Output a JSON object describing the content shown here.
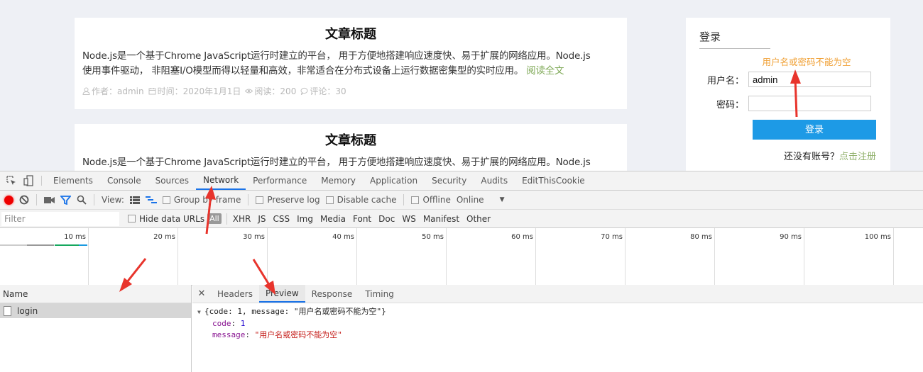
{
  "page": {
    "articles": [
      {
        "title": "文章标题",
        "body_line1": "Node.js是一个基于Chrome JavaScript运行时建立的平台， 用于方便地搭建响应速度快、易于扩展的网络应用。Node.js",
        "body_line2": "使用事件驱动， 非阻塞I/O模型而得以轻量和高效，非常适合在分布式设备上运行数据密集型的实时应用。",
        "read_more": "阅读全文",
        "meta": {
          "author": "作者：admin",
          "time": "时间：2020年1月1日",
          "reads": "阅读：200",
          "comments": "评论：30"
        }
      },
      {
        "title": "文章标题",
        "body_line1": "Node.js是一个基于Chrome JavaScript运行时建立的平台， 用于方便地搭建响应速度快、易于扩展的网络应用。Node.js"
      }
    ],
    "login": {
      "title": "登录",
      "error": "用户名或密码不能为空",
      "username_label": "用户名：",
      "username_value": "admin",
      "password_label": "密码：",
      "password_value": "",
      "submit": "登录",
      "register_prompt": "还没有账号？",
      "register_link": "点击注册"
    }
  },
  "devtools": {
    "tabs": [
      "Elements",
      "Console",
      "Sources",
      "Network",
      "Performance",
      "Memory",
      "Application",
      "Security",
      "Audits",
      "EditThisCookie"
    ],
    "active_tab": "Network",
    "toolbar": {
      "view_label": "View:",
      "group_by_frame": "Group by frame",
      "preserve_log": "Preserve log",
      "disable_cache": "Disable cache",
      "offline": "Offline",
      "throttle": "Online"
    },
    "filterbar": {
      "placeholder": "Filter",
      "hide_data_urls": "Hide data URLs",
      "all": "All",
      "types": [
        "XHR",
        "JS",
        "CSS",
        "Img",
        "Media",
        "Font",
        "Doc",
        "WS",
        "Manifest",
        "Other"
      ]
    },
    "timeline_ticks": [
      "10 ms",
      "20 ms",
      "30 ms",
      "40 ms",
      "50 ms",
      "60 ms",
      "70 ms",
      "80 ms",
      "90 ms",
      "100 ms"
    ],
    "requests": {
      "column": "Name",
      "rows": [
        "login"
      ]
    },
    "detail": {
      "tabs": [
        "Headers",
        "Preview",
        "Response",
        "Timing"
      ],
      "active_tab": "Preview",
      "preview": {
        "summary": "{code: 1, message: \"用户名或密码不能为空\"}",
        "code_key": "code",
        "code_value": "1",
        "message_key": "message",
        "message_value": "\"用户名或密码不能为空\""
      }
    }
  },
  "colors": {
    "accent_blue": "#1d9ae6",
    "error_orange": "#f0a035",
    "link_green": "#7fa957",
    "annotation_red": "#e8342c"
  }
}
